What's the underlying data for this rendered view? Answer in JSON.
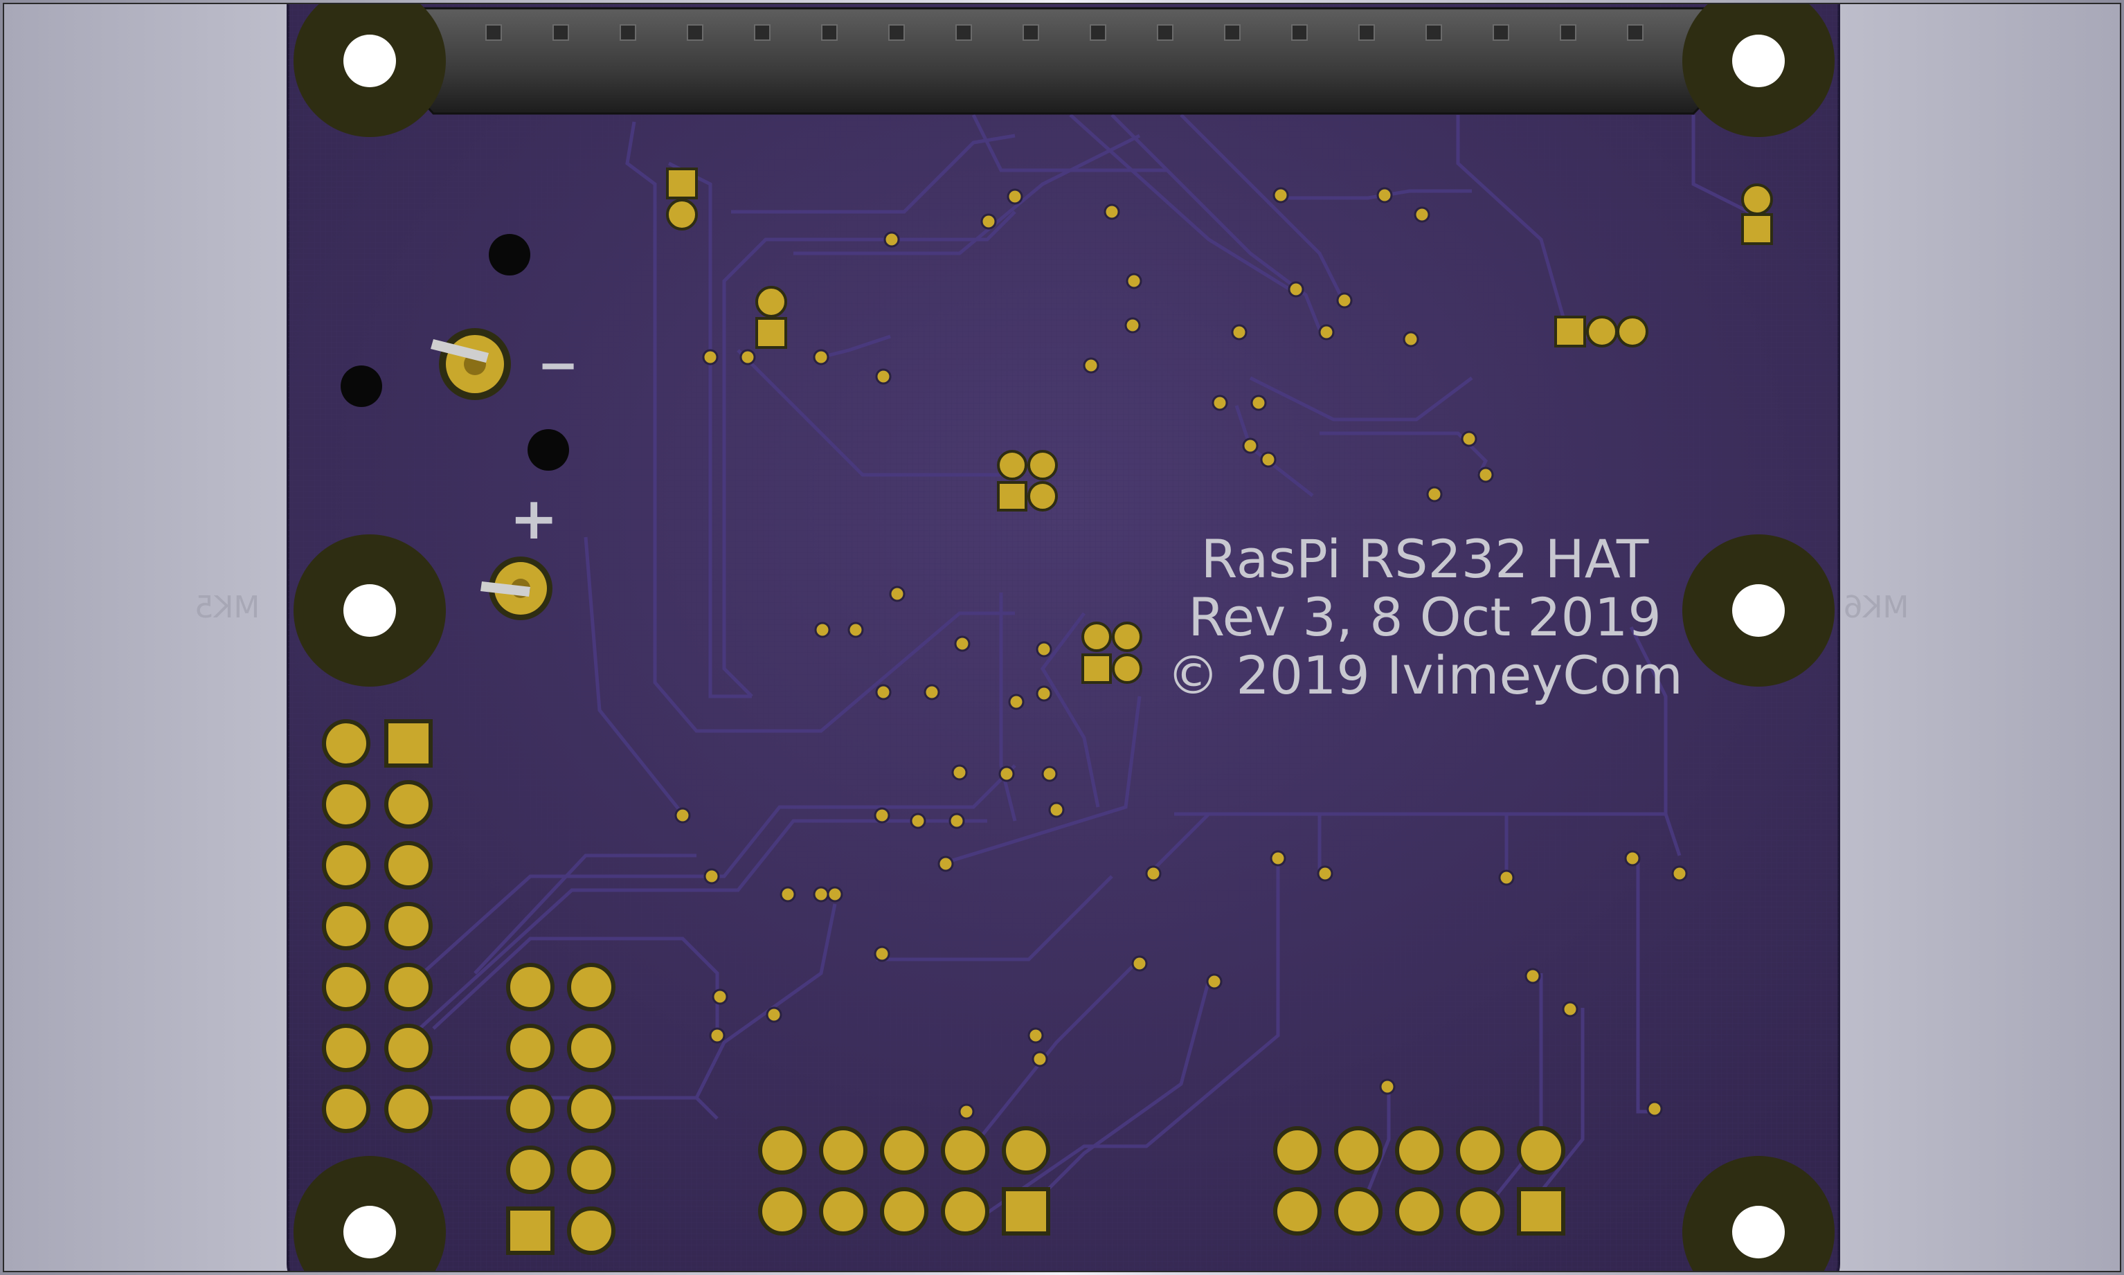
{
  "board": {
    "silkscreen": {
      "title_line1": "RasPi RS232 HAT",
      "title_line2": "Rev 3, 8 Oct 2019",
      "title_line3": "© 2019 IvimeyCom",
      "minus_sign": "−",
      "plus_sign": "+",
      "mk5_label": "MK5",
      "mk6_label": "MK6"
    },
    "colors": {
      "pcb": "#3a2b5e",
      "trace": "#4a3a80",
      "pad_gold": "#c9a82c",
      "mount_ring": "#2e2d12",
      "silkscreen": "#c8c8d0",
      "connector": "#4a4a4a"
    }
  }
}
